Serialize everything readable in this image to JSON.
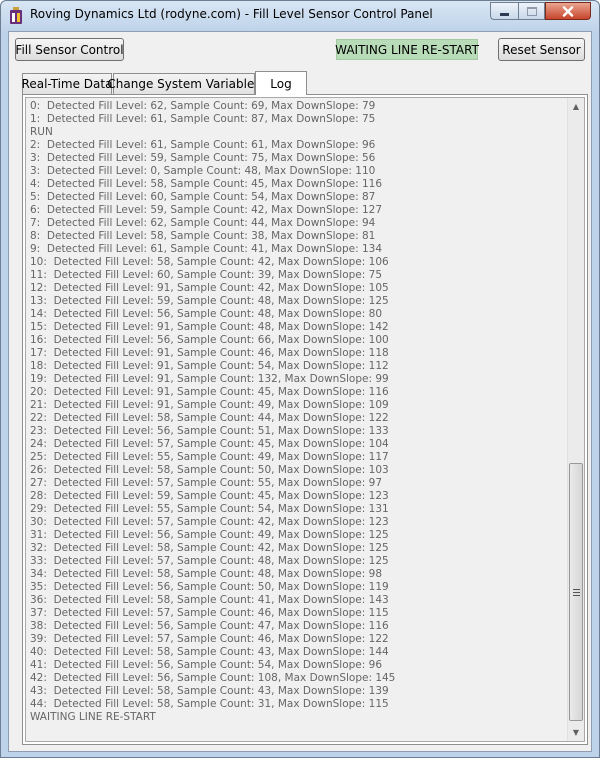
{
  "window": {
    "title": "Roving Dynamics Ltd (rodyne.com) - Fill Level Sensor Control Panel",
    "app_icon": "app-logo-icon",
    "controls": [
      "minimize-icon",
      "maximize-icon",
      "close-icon"
    ]
  },
  "toolbar": {
    "fill_sensor_label": "Fill Sensor Control",
    "status_text": "WAITING LINE RE-START",
    "status_color": "#b9dcb8",
    "reset_label": "Reset Sensor"
  },
  "tabs": [
    {
      "label": "Real-Time Data",
      "active": false
    },
    {
      "label": "Change System Variables",
      "active": false
    },
    {
      "label": "Log",
      "active": true
    }
  ],
  "log": [
    "0:  Detected Fill Level: 62, Sample Count: 69, Max DownSlope: 79",
    "1:  Detected Fill Level: 61, Sample Count: 87, Max DownSlope: 75",
    "RUN",
    "2:  Detected Fill Level: 61, Sample Count: 61, Max DownSlope: 96",
    "3:  Detected Fill Level: 59, Sample Count: 75, Max DownSlope: 56",
    "3:  Detected Fill Level: 0, Sample Count: 48, Max DownSlope: 110",
    "4:  Detected Fill Level: 58, Sample Count: 45, Max DownSlope: 116",
    "5:  Detected Fill Level: 60, Sample Count: 54, Max DownSlope: 87",
    "6:  Detected Fill Level: 59, Sample Count: 42, Max DownSlope: 127",
    "7:  Detected Fill Level: 62, Sample Count: 44, Max DownSlope: 94",
    "8:  Detected Fill Level: 58, Sample Count: 38, Max DownSlope: 81",
    "9:  Detected Fill Level: 61, Sample Count: 41, Max DownSlope: 134",
    "10:  Detected Fill Level: 58, Sample Count: 42, Max DownSlope: 106",
    "11:  Detected Fill Level: 60, Sample Count: 39, Max DownSlope: 75",
    "12:  Detected Fill Level: 91, Sample Count: 42, Max DownSlope: 105",
    "13:  Detected Fill Level: 59, Sample Count: 48, Max DownSlope: 125",
    "14:  Detected Fill Level: 56, Sample Count: 48, Max DownSlope: 80",
    "15:  Detected Fill Level: 91, Sample Count: 48, Max DownSlope: 142",
    "16:  Detected Fill Level: 56, Sample Count: 66, Max DownSlope: 100",
    "17:  Detected Fill Level: 91, Sample Count: 46, Max DownSlope: 118",
    "18:  Detected Fill Level: 91, Sample Count: 54, Max DownSlope: 112",
    "19:  Detected Fill Level: 91, Sample Count: 132, Max DownSlope: 99",
    "20:  Detected Fill Level: 91, Sample Count: 45, Max DownSlope: 116",
    "21:  Detected Fill Level: 91, Sample Count: 49, Max DownSlope: 109",
    "22:  Detected Fill Level: 58, Sample Count: 44, Max DownSlope: 122",
    "23:  Detected Fill Level: 56, Sample Count: 51, Max DownSlope: 133",
    "24:  Detected Fill Level: 57, Sample Count: 45, Max DownSlope: 104",
    "25:  Detected Fill Level: 55, Sample Count: 49, Max DownSlope: 117",
    "26:  Detected Fill Level: 58, Sample Count: 50, Max DownSlope: 103",
    "27:  Detected Fill Level: 57, Sample Count: 55, Max DownSlope: 97",
    "28:  Detected Fill Level: 59, Sample Count: 45, Max DownSlope: 123",
    "29:  Detected Fill Level: 55, Sample Count: 54, Max DownSlope: 131",
    "30:  Detected Fill Level: 57, Sample Count: 42, Max DownSlope: 123",
    "31:  Detected Fill Level: 56, Sample Count: 49, Max DownSlope: 125",
    "32:  Detected Fill Level: 58, Sample Count: 42, Max DownSlope: 125",
    "33:  Detected Fill Level: 57, Sample Count: 48, Max DownSlope: 125",
    "34:  Detected Fill Level: 58, Sample Count: 48, Max DownSlope: 98",
    "35:  Detected Fill Level: 56, Sample Count: 50, Max DownSlope: 119",
    "36:  Detected Fill Level: 58, Sample Count: 41, Max DownSlope: 143",
    "37:  Detected Fill Level: 57, Sample Count: 46, Max DownSlope: 115",
    "38:  Detected Fill Level: 56, Sample Count: 47, Max DownSlope: 116",
    "39:  Detected Fill Level: 57, Sample Count: 46, Max DownSlope: 122",
    "40:  Detected Fill Level: 58, Sample Count: 43, Max DownSlope: 144",
    "41:  Detected Fill Level: 56, Sample Count: 54, Max DownSlope: 96",
    "42:  Detected Fill Level: 56, Sample Count: 108, Max DownSlope: 145",
    "43:  Detected Fill Level: 58, Sample Count: 43, Max DownSlope: 139",
    "44:  Detected Fill Level: 58, Sample Count: 31, Max DownSlope: 115",
    "WAITING LINE RE-START"
  ],
  "scrollbar": {
    "up_icon": "scroll-up-arrow-icon",
    "down_icon": "scroll-down-arrow-icon",
    "position": 0.58
  }
}
